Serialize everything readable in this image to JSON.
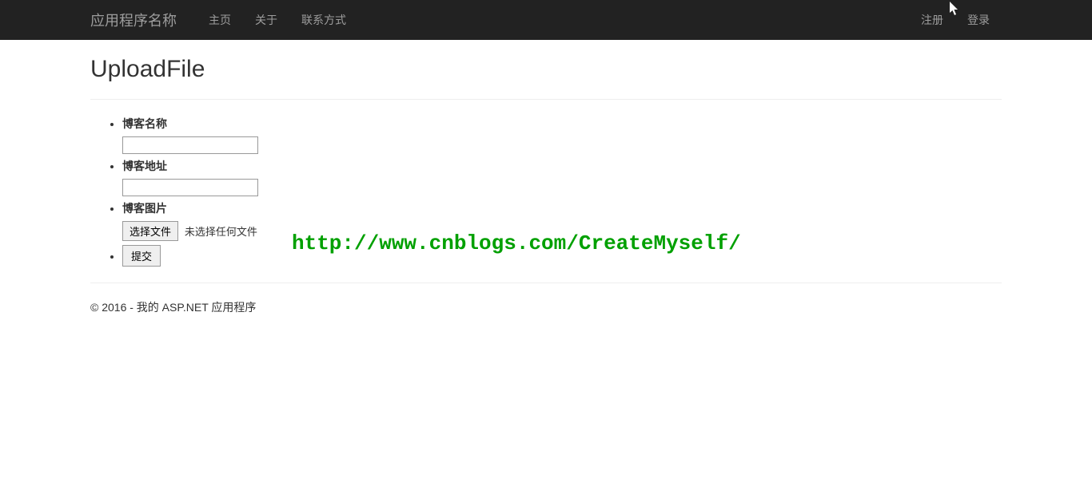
{
  "navbar": {
    "brand": "应用程序名称",
    "links": {
      "home": "主页",
      "about": "关于",
      "contact": "联系方式"
    },
    "right": {
      "register": "注册",
      "login": "登录"
    }
  },
  "page": {
    "title": "UploadFile"
  },
  "form": {
    "blogName": {
      "label": "博客名称",
      "value": ""
    },
    "blogAddress": {
      "label": "博客地址",
      "value": ""
    },
    "blogImage": {
      "label": "博客图片",
      "chooseButton": "选择文件",
      "noFileText": "未选择任何文件"
    },
    "submit": "提交"
  },
  "watermark": "http://www.cnblogs.com/CreateMyself/",
  "footer": "© 2016 - 我的 ASP.NET 应用程序"
}
